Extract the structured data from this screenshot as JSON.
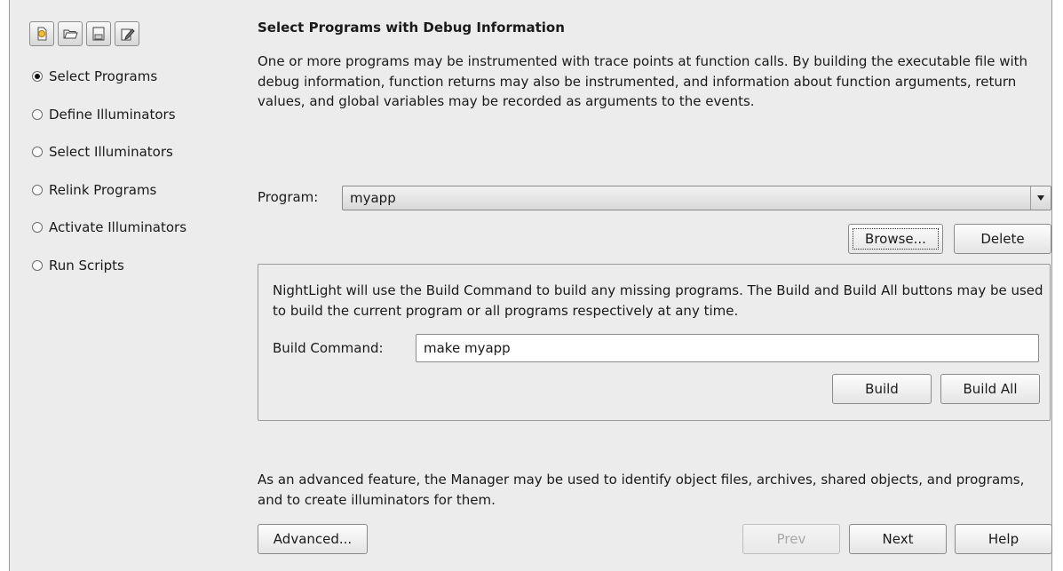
{
  "nav": {
    "items": [
      {
        "label": "Select Programs",
        "checked": true
      },
      {
        "label": "Define Illuminators",
        "checked": false
      },
      {
        "label": "Select Illuminators",
        "checked": false
      },
      {
        "label": "Relink Programs",
        "checked": false
      },
      {
        "label": "Activate Illuminators",
        "checked": false
      },
      {
        "label": "Run Scripts",
        "checked": false
      }
    ]
  },
  "toolbar": {
    "icons": [
      "new-icon",
      "open-folder-icon",
      "save-icon",
      "edit-icon"
    ]
  },
  "main": {
    "title": "Select Programs with Debug Information",
    "intro": "One or more programs may be instrumented with trace points at function calls. By building the executable file with debug information, function returns may also be instrumented, and information about function arguments, return values, and global variables may be recorded as arguments to the events.",
    "program_label": "Program:",
    "program_value": "myapp",
    "browse_label": "Browse...",
    "delete_label": "Delete"
  },
  "build": {
    "text": "NightLight will use the Build Command to build any missing programs. The Build and Build All buttons may be used to build the current program or all programs respectively at any time.",
    "command_label": "Build Command:",
    "command_value": "make myapp",
    "build_label": "Build",
    "build_all_label": "Build All"
  },
  "footer": {
    "advanced_text": "As an advanced feature, the Manager may be used to identify object files, archives, shared objects, and programs, and to create illuminators for them.",
    "advanced_label": "Advanced...",
    "prev_label": "Prev",
    "next_label": "Next",
    "help_label": "Help"
  },
  "colors": {
    "panel": "#ececec",
    "border": "#9a9a9a"
  }
}
